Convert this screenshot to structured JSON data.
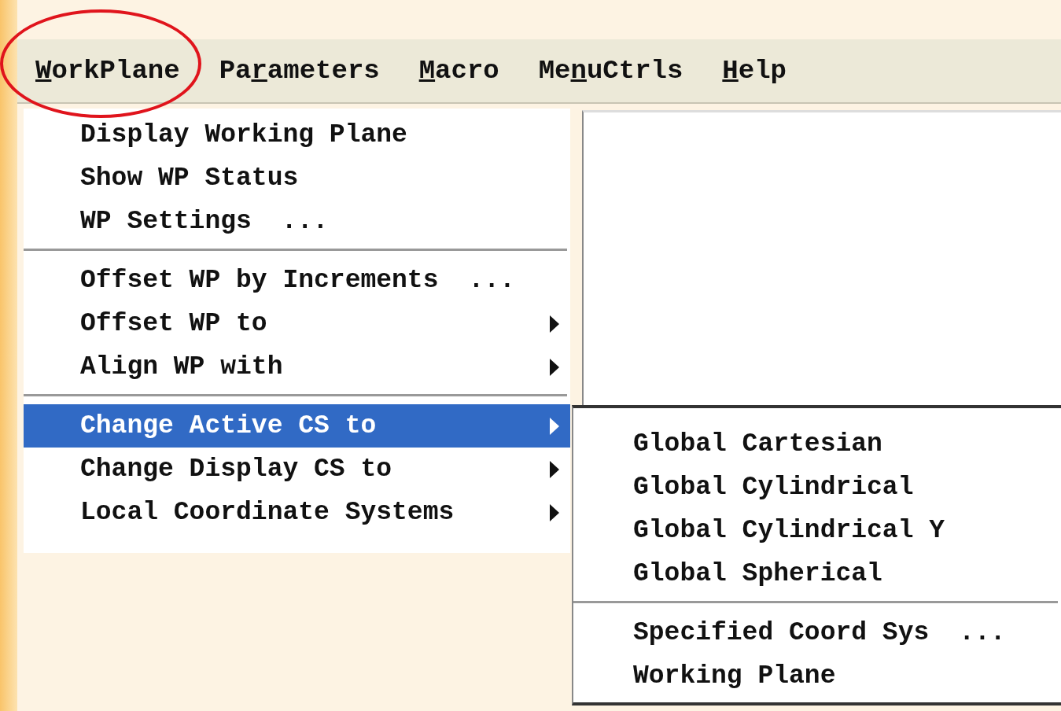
{
  "menu_bar": [
    {
      "access_key": "W",
      "label_after": "orkPlane",
      "circled": true
    },
    {
      "label_before": "Pa",
      "access_key": "r",
      "label_after": "ameters",
      "circled": false
    },
    {
      "access_key": "M",
      "label_after": "acro",
      "circled": false
    },
    {
      "label_before": "Me",
      "access_key": "n",
      "label_after": "uCtrls",
      "circled": false
    },
    {
      "access_key": "H",
      "label_after": "elp",
      "circled": false
    }
  ],
  "dropdown": {
    "sections": [
      [
        {
          "label": "Display Working Plane",
          "has_submenu": false,
          "selected": false
        },
        {
          "label": "Show WP Status",
          "has_submenu": false,
          "selected": false
        },
        {
          "label": "WP Settings",
          "ellipsis": "...",
          "has_submenu": false,
          "selected": false
        }
      ],
      [
        {
          "label": "Offset WP by Increments",
          "ellipsis": "...",
          "has_submenu": false,
          "selected": false
        },
        {
          "label": "Offset WP to",
          "has_submenu": true,
          "selected": false
        },
        {
          "label": "Align WP with",
          "has_submenu": true,
          "selected": false
        }
      ],
      [
        {
          "label": "Change Active CS to",
          "has_submenu": true,
          "selected": true
        },
        {
          "label": "Change Display CS to",
          "has_submenu": true,
          "selected": false
        },
        {
          "label": "Local Coordinate Systems",
          "has_submenu": true,
          "selected": false
        }
      ]
    ]
  },
  "submenu": {
    "sections": [
      [
        {
          "label": "Global Cartesian"
        },
        {
          "label": "Global Cylindrical"
        },
        {
          "label": "Global Cylindrical Y"
        },
        {
          "label": "Global Spherical"
        }
      ],
      [
        {
          "label": "Specified Coord Sys",
          "ellipsis": "..."
        },
        {
          "label": "Working Plane"
        }
      ]
    ]
  }
}
